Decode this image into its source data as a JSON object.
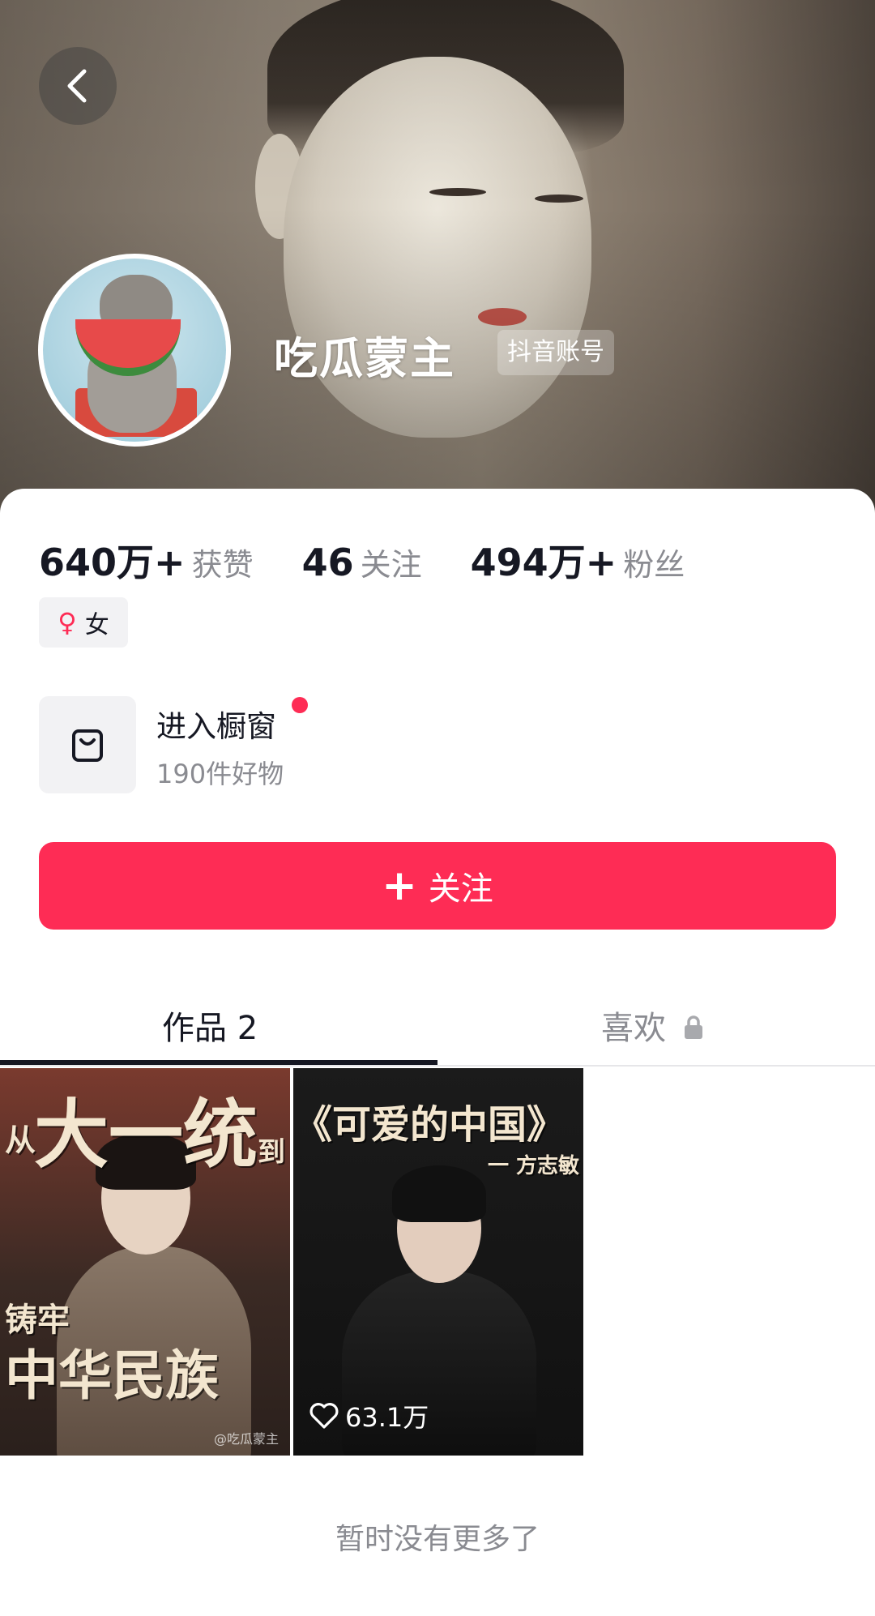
{
  "header": {
    "username": "吃瓜蒙主",
    "account_tag": "抖音账号"
  },
  "stats": [
    {
      "value": "640万+",
      "label": "获赞"
    },
    {
      "value": "46",
      "label": "关注"
    },
    {
      "value": "494万+",
      "label": "粉丝"
    }
  ],
  "gender": {
    "symbol": "♀",
    "label": "女"
  },
  "shop": {
    "title": "进入橱窗",
    "subtitle": "190件好物"
  },
  "follow_button": {
    "plus": "+",
    "label": "关注"
  },
  "tabs": [
    {
      "label": "作品 2"
    },
    {
      "label": "喜欢"
    }
  ],
  "videos": [
    {
      "overlay_top_small": "从",
      "overlay_top_big": "大一统",
      "overlay_top_tail": "到",
      "overlay_mid": "铸牢",
      "overlay_bottom": "中华民族",
      "watermark": "@吃瓜蒙主"
    },
    {
      "overlay_title": "《可爱的中国》",
      "overlay_author": "一 方志敏",
      "likes": "63.1万"
    }
  ],
  "footer": {
    "no_more": "暂时没有更多了"
  },
  "colors": {
    "accent": "#fe2c55",
    "text": "#161823",
    "muted": "#8a8b91"
  }
}
